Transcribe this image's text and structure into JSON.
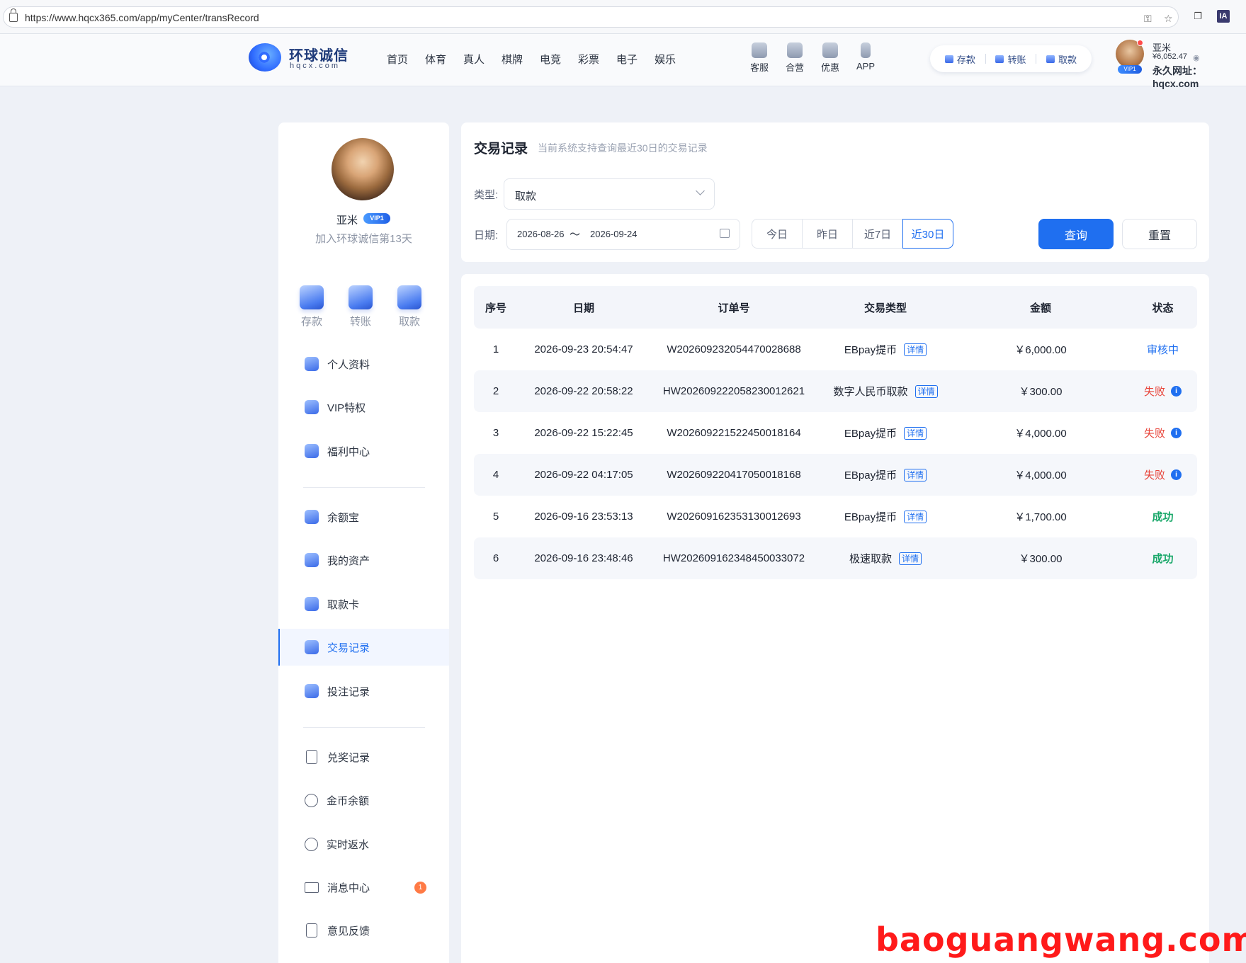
{
  "browser": {
    "url": "https://www.hqcx365.com/app/myCenter/transRecord",
    "ia_label": "IA"
  },
  "header": {
    "logo_cn": "环球诚信",
    "logo_en": "hqcx.com",
    "nav": [
      "首页",
      "体育",
      "真人",
      "棋牌",
      "电竞",
      "彩票",
      "电子",
      "娱乐"
    ],
    "quick": [
      "客服",
      "合营",
      "优惠",
      "APP"
    ],
    "pill": [
      "存款",
      "转账",
      "取款"
    ],
    "user": {
      "name": "亚米",
      "vip": "VIP1",
      "balance": "¥6,052.47",
      "perm_url": "永久网址：hqcx.com"
    }
  },
  "sidebar": {
    "name": "亚米",
    "vip": "VIP1",
    "joined": "加入环球诚信第13天",
    "fund_buttons": [
      "存款",
      "转账",
      "取款"
    ],
    "menu_group1": [
      {
        "label": "个人资料",
        "icon": "id-card-icon"
      },
      {
        "label": "VIP特权",
        "icon": "crown-icon"
      },
      {
        "label": "福利中心",
        "icon": "gift-icon"
      }
    ],
    "menu_group2": [
      {
        "label": "余额宝",
        "icon": "wallet-icon"
      },
      {
        "label": "我的资产",
        "icon": "assets-icon"
      },
      {
        "label": "取款卡",
        "icon": "bank-card-icon"
      },
      {
        "label": "交易记录",
        "icon": "transaction-icon"
      },
      {
        "label": "投注记录",
        "icon": "bet-record-icon"
      }
    ],
    "menu_group3": [
      {
        "label": "兑奖记录",
        "icon": "clipboard-icon"
      },
      {
        "label": "金币余额",
        "icon": "coin-icon"
      },
      {
        "label": "实时返水",
        "icon": "rebate-icon"
      },
      {
        "label": "消息中心",
        "icon": "mail-icon",
        "badge": "1"
      },
      {
        "label": "意见反馈",
        "icon": "feedback-icon"
      }
    ],
    "active": "交易记录"
  },
  "filter": {
    "title": "交易记录",
    "subtitle": "当前系统支持查询最近30日的交易记录",
    "type_label": "类型:",
    "type_value": "取款",
    "date_label": "日期:",
    "date_from": "2026-08-26",
    "date_sep": "〜",
    "date_to": "2026-09-24",
    "ranges": [
      "今日",
      "昨日",
      "近7日",
      "近30日"
    ],
    "active_range": "近30日",
    "query": "查询",
    "reset": "重置"
  },
  "table": {
    "headers": [
      "序号",
      "日期",
      "订单号",
      "交易类型",
      "金额",
      "状态"
    ],
    "detail_label": "详情",
    "rows": [
      {
        "no": "1",
        "date": "2026-09-23 20:54:47",
        "order": "W2026092320544700286​88",
        "type": "EBpay提币",
        "amount": "￥6,000.00",
        "status": "审核中",
        "status_kind": "review"
      },
      {
        "no": "2",
        "date": "2026-09-22 20:58:22",
        "order": "HW2026092220582300126​21",
        "type": "数字人民币取款",
        "amount": "￥300.00",
        "status": "失败",
        "status_kind": "fail"
      },
      {
        "no": "3",
        "date": "2026-09-22 15:22:45",
        "order": "W2026092215224500181​64",
        "type": "EBpay提币",
        "amount": "￥4,000.00",
        "status": "失败",
        "status_kind": "fail"
      },
      {
        "no": "4",
        "date": "2026-09-22 04:17:05",
        "order": "W2026092204170500181​68",
        "type": "EBpay提币",
        "amount": "￥4,000.00",
        "status": "失败",
        "status_kind": "fail"
      },
      {
        "no": "5",
        "date": "2026-09-16 23:53:13",
        "order": "W2026091623531300126​93",
        "type": "EBpay提币",
        "amount": "￥1,700.00",
        "status": "成功",
        "status_kind": "ok"
      },
      {
        "no": "6",
        "date": "2026-09-16 23:48:46",
        "order": "HW2026091623484500330​72",
        "type": "极速取款",
        "amount": "￥300.00",
        "status": "成功",
        "status_kind": "ok"
      }
    ]
  },
  "watermark": "baoguangwang.com"
}
